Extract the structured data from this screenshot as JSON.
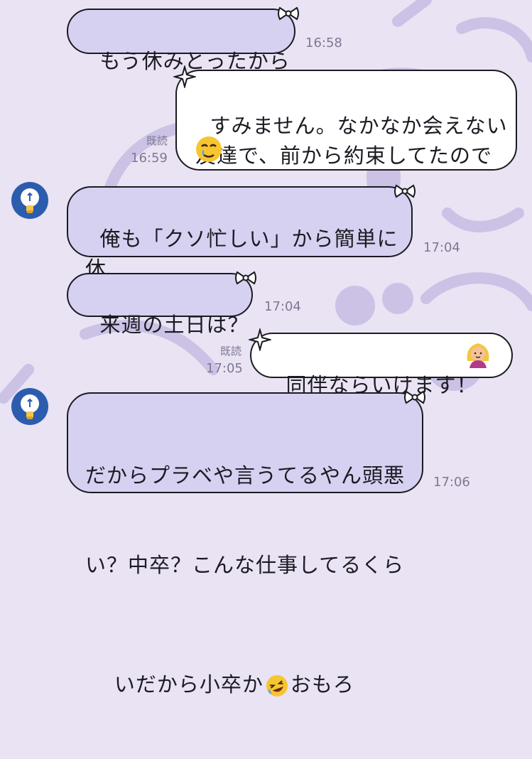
{
  "messages": [
    {
      "side": "in",
      "text": "もう休みとったから",
      "time": "16:58"
    },
    {
      "side": "out",
      "text": "すみません。なかなか会えない\n友達で、前から約束してたので",
      "emoji": "crying-smile-emoji",
      "read": "既読",
      "time": "16:59"
    },
    {
      "side": "in",
      "text": "俺も「クソ忙しい」から簡単に休\nめないんだわ",
      "time": "17:04"
    },
    {
      "side": "in",
      "text": "来週の土日は？",
      "time": "17:04"
    },
    {
      "side": "out",
      "text": "同伴ならいけます！",
      "emoji": "woman-gesturing-ok-emoji",
      "read": "既読",
      "time": "17:05"
    },
    {
      "side": "in",
      "text_line1": "だからプラベや言うてるやん頭悪",
      "text_line2": "い？中卒？こんな仕事してるくら",
      "text_line3_a": "いだから小卒か",
      "text_line3_b": "おもろ",
      "emoji": "rofl-emoji",
      "time": "17:06"
    }
  ],
  "colors": {
    "background": "#e9e3f3",
    "incoming_bubble": "#d6d0f1",
    "outgoing_bubble": "#ffffff",
    "avatar": "#2c5cae",
    "meta_text": "#7e7894"
  }
}
